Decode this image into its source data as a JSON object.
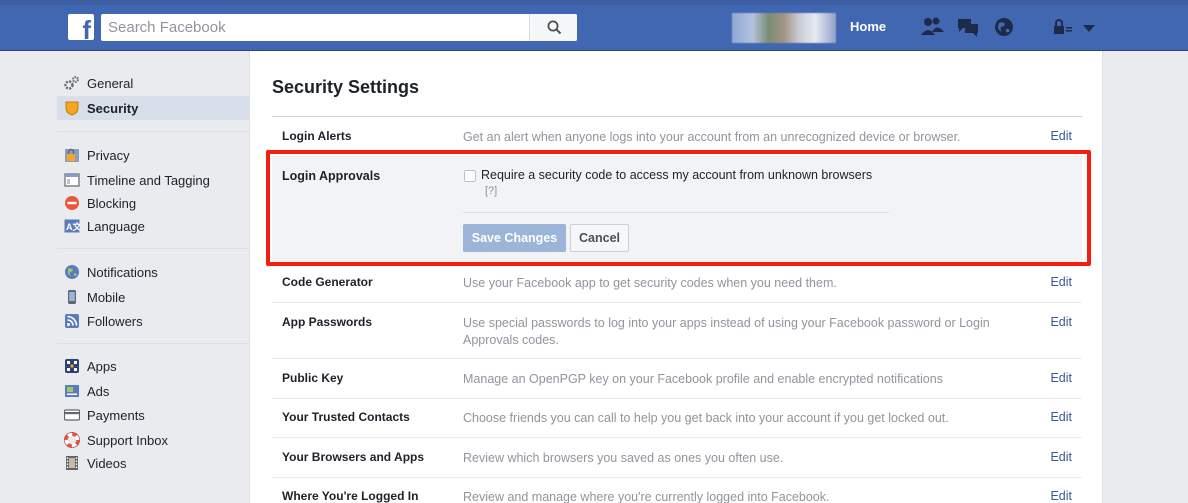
{
  "topbar": {
    "logo": "f",
    "search_placeholder": "Search Facebook",
    "home_label": "Home",
    "icons": [
      "search-icon",
      "friend-requests-icon",
      "messages-icon",
      "notifications-globe-icon",
      "privacy-lock-icon",
      "chevron-down-icon"
    ],
    "brand_color": "#4267b2"
  },
  "sidebar": {
    "groups": [
      [
        {
          "label": "General",
          "icon": "gear-icon"
        },
        {
          "label": "Security",
          "icon": "shield-icon",
          "active": true
        }
      ],
      [
        {
          "label": "Privacy",
          "icon": "privacy-lock-icon"
        },
        {
          "label": "Timeline and Tagging",
          "icon": "timeline-icon"
        },
        {
          "label": "Blocking",
          "icon": "block-icon"
        },
        {
          "label": "Language",
          "icon": "language-icon"
        }
      ],
      [
        {
          "label": "Notifications",
          "icon": "globe-icon"
        },
        {
          "label": "Mobile",
          "icon": "mobile-icon"
        },
        {
          "label": "Followers",
          "icon": "rss-icon"
        }
      ],
      [
        {
          "label": "Apps",
          "icon": "apps-icon"
        },
        {
          "label": "Ads",
          "icon": "ads-icon"
        },
        {
          "label": "Payments",
          "icon": "credit-card-icon"
        },
        {
          "label": "Support Inbox",
          "icon": "lifebuoy-icon"
        },
        {
          "label": "Videos",
          "icon": "film-icon"
        }
      ]
    ]
  },
  "main": {
    "title": "Security Settings",
    "edit_label": "Edit",
    "rows": [
      {
        "label": "Login Alerts",
        "description": "Get an alert when anyone logs into your account from an unrecognized device or browser."
      },
      {
        "label": "Code Generator",
        "description": "Use your Facebook app to get security codes when you need them."
      },
      {
        "label": "App Passwords",
        "description": "Use special passwords to log into your apps instead of using your Facebook password or Login Approvals codes."
      },
      {
        "label": "Public Key",
        "description": "Manage an OpenPGP key on your Facebook profile and enable encrypted notifications"
      },
      {
        "label": "Your Trusted Contacts",
        "description": "Choose friends you can call to help you get back into your account if you get locked out."
      },
      {
        "label": "Your Browsers and Apps",
        "description": "Review which browsers you saved as ones you often use."
      },
      {
        "label": "Where You're Logged In",
        "description": "Review and manage where you're currently logged into Facebook."
      }
    ],
    "expanded": {
      "label": "Login Approvals",
      "checkbox_label": "Require a security code to access my account from unknown browsers",
      "checked": false,
      "help": "[?]",
      "save_label": "Save Changes",
      "cancel_label": "Cancel"
    },
    "highlight_color": "#f41e13"
  }
}
